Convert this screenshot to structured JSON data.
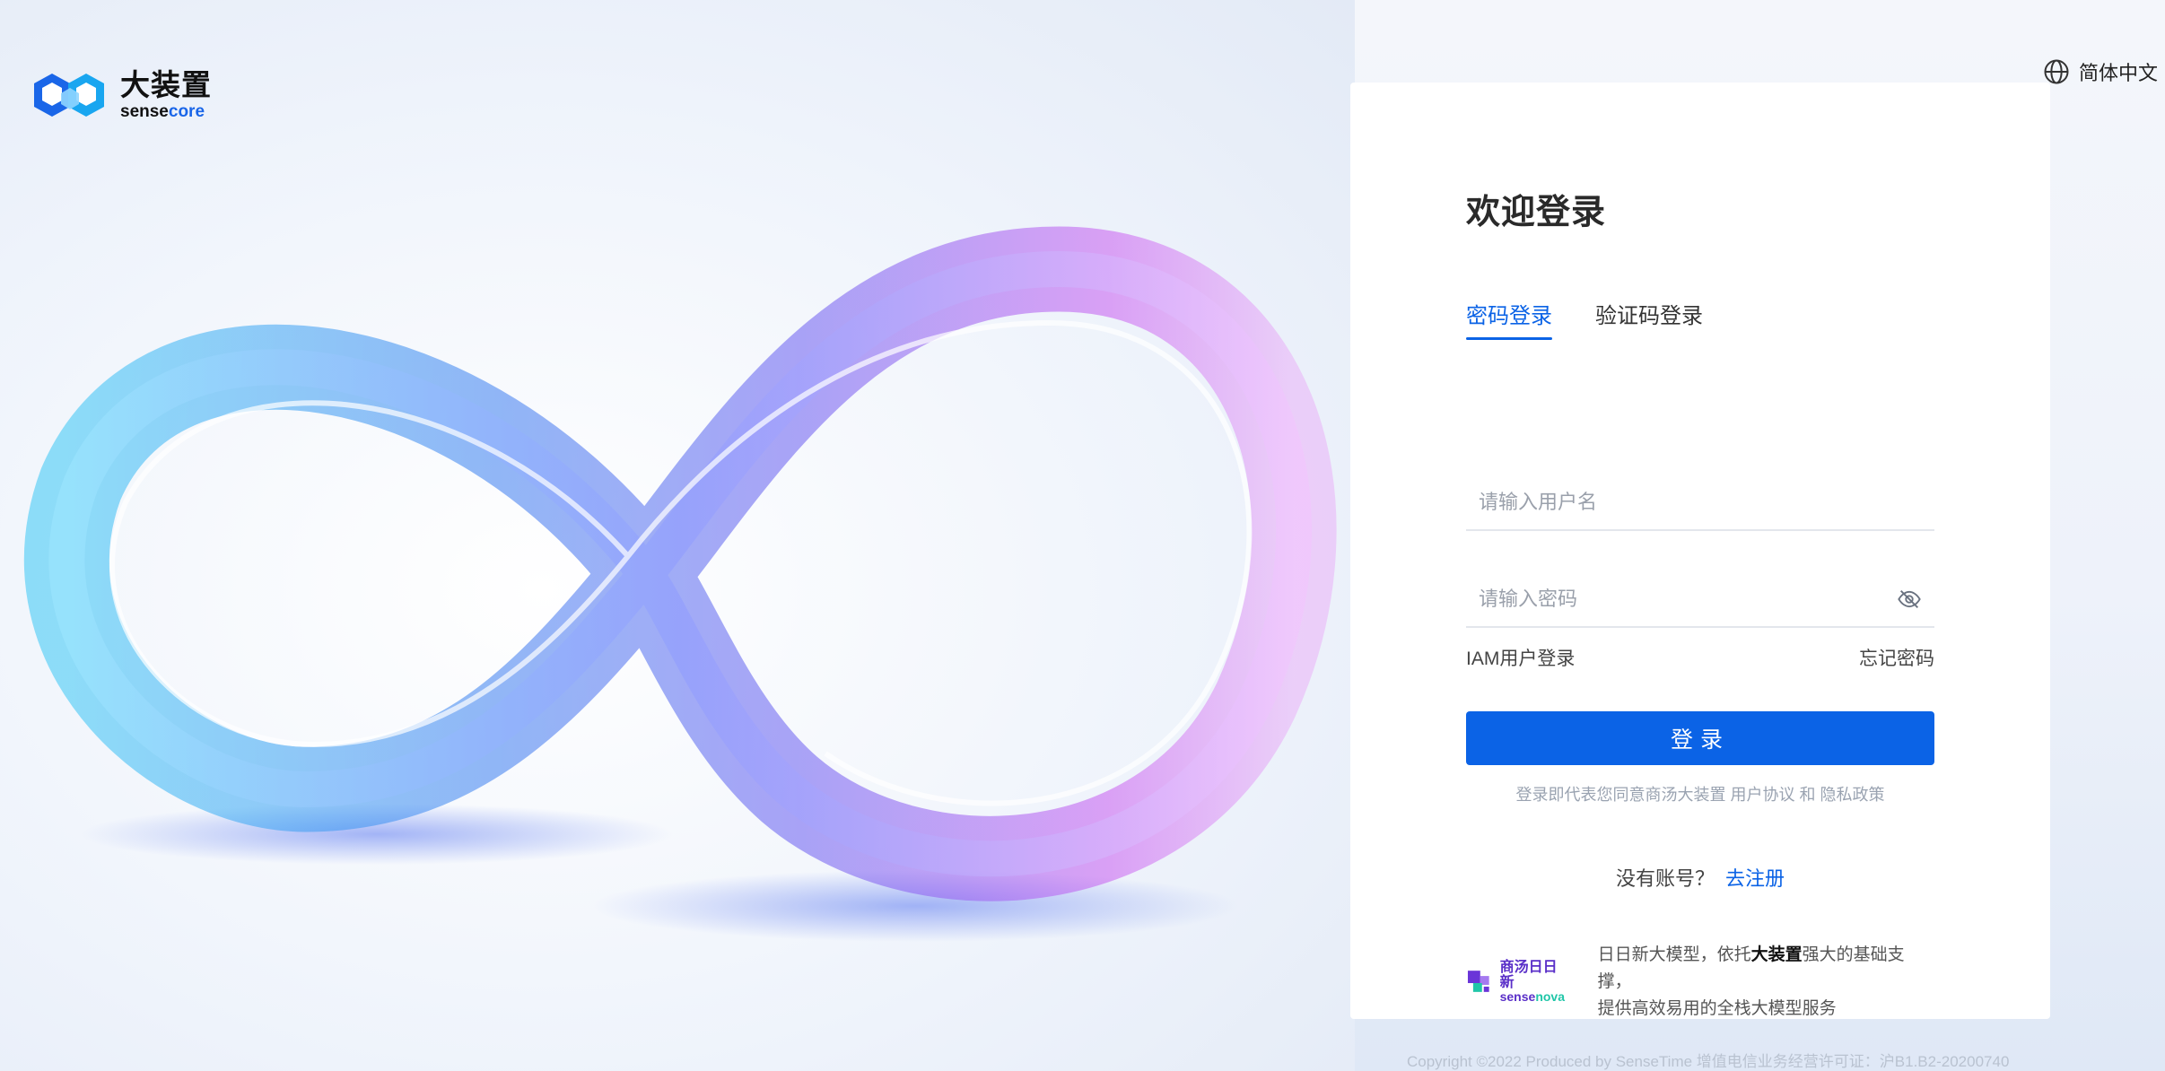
{
  "brand": {
    "title": "大装置",
    "sub_prefix": "sense",
    "sub_accent": "core"
  },
  "language": {
    "label": "简体中文",
    "icon": "globe-icon"
  },
  "login": {
    "heading": "欢迎登录",
    "tabs": [
      {
        "label": "密码登录",
        "active": true
      },
      {
        "label": "验证码登录",
        "active": false
      }
    ],
    "username_placeholder": "请输入用户名",
    "username_value": "",
    "password_placeholder": "请输入密码",
    "password_value": "",
    "password_toggle_icon": "eye-off-icon",
    "iam_link": "IAM用户登录",
    "forgot_link": "忘记密码",
    "submit_label": "登录",
    "agreement": {
      "prefix": "登录即代表您同意商汤大装置",
      "user_agreement": "用户协议",
      "and": "和",
      "privacy": "隐私政策"
    },
    "register": {
      "question": "没有账号？",
      "link": "去注册"
    }
  },
  "promo": {
    "brand_cn": "商汤日日新",
    "brand_en_a": "sense",
    "brand_en_b": "nova",
    "text_before": "日日新大模型，依托",
    "text_bold": "大装置",
    "text_after": "强大的基础支撑，",
    "text_line2": "提供高效易用的全栈大模型服务"
  },
  "footer": "Copyright ©2022 Produced by SenseTime  增值电信业务经营许可证：沪B1.B2-20200740",
  "colors": {
    "primary": "#0b63e6",
    "brand_blue": "#1a66e8",
    "nova_purple": "#5a2fc8",
    "nova_green": "#20c6a8"
  }
}
